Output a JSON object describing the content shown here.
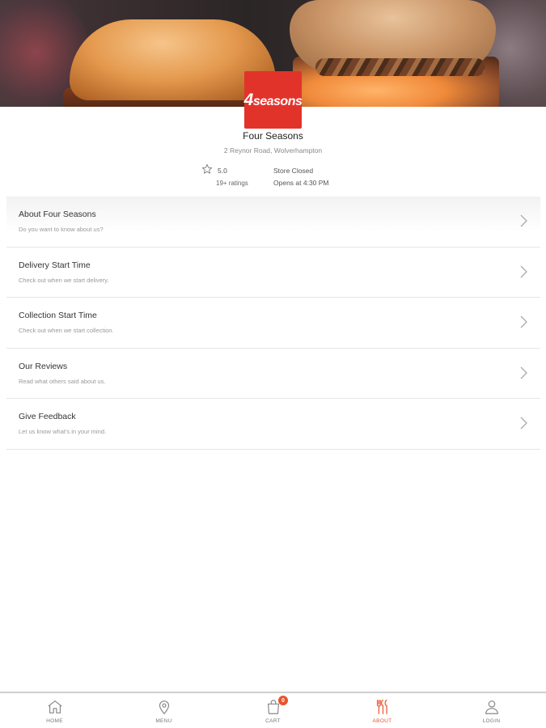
{
  "store": {
    "logo_number": "4",
    "logo_word": "seasons",
    "name": "Four Seasons",
    "address": "2 Reynor Road, Wolverhampton",
    "rating": "5.0",
    "rating_count": "19+ ratings",
    "status": "Store Closed",
    "opens": "Opens at 4:30 PM"
  },
  "menu": {
    "items": [
      {
        "title": "About Four Seasons",
        "subtitle": "Do you want to know about us?"
      },
      {
        "title": "Delivery Start Time",
        "subtitle": "Check out when we start delivery."
      },
      {
        "title": "Collection Start Time",
        "subtitle": "Check out when we start collection."
      },
      {
        "title": "Our Reviews",
        "subtitle": "Read what others said about us."
      },
      {
        "title": "Give Feedback",
        "subtitle": "Let us know what's in your mind."
      }
    ]
  },
  "nav": {
    "home": "HOME",
    "menu": "MENU",
    "cart": "CART",
    "cart_count": "0",
    "about": "ABOUT",
    "login": "LOGIN",
    "active": "about"
  },
  "colors": {
    "brand": "#e2332b",
    "accent": "#e8542c"
  }
}
